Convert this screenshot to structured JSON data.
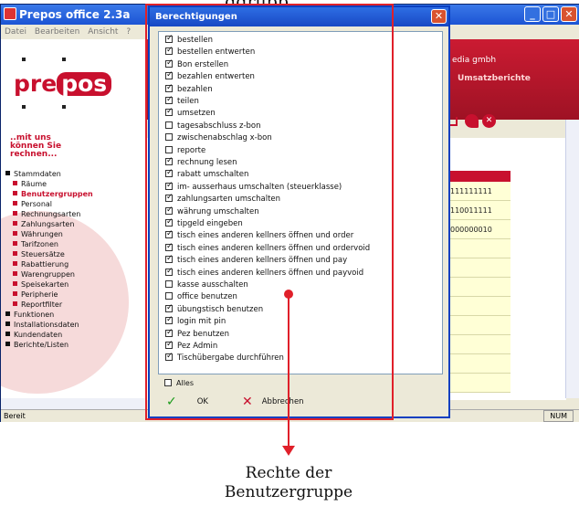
{
  "top_caption_fragment": "...ggrupp...",
  "app": {
    "title": "Prepos office 2.3a",
    "menu": [
      "Datei",
      "Bearbeiten",
      "Ansicht",
      "?"
    ],
    "logo_prefix": "pre",
    "logo_box": "pos",
    "company": "edia gmbh",
    "header_link": "Umsatzberichte",
    "slogan": [
      "..mit uns",
      "können Sie",
      "rechnen..."
    ],
    "nav": [
      {
        "label": "Stammdaten",
        "level": 1,
        "active": false
      },
      {
        "label": "Räume",
        "level": 2,
        "active": false
      },
      {
        "label": "Benutzergruppen",
        "level": 2,
        "active": true
      },
      {
        "label": "Personal",
        "level": 2,
        "active": false
      },
      {
        "label": "Rechnungsarten",
        "level": 2,
        "active": false
      },
      {
        "label": "Zahlungsarten",
        "level": 2,
        "active": false
      },
      {
        "label": "Währungen",
        "level": 2,
        "active": false
      },
      {
        "label": "Tarifzonen",
        "level": 2,
        "active": false
      },
      {
        "label": "Steuersätze",
        "level": 2,
        "active": false
      },
      {
        "label": "Rabattierung",
        "level": 2,
        "active": false
      },
      {
        "label": "Warengruppen",
        "level": 2,
        "active": false
      },
      {
        "label": "Speisekarten",
        "level": 2,
        "active": false
      },
      {
        "label": "Peripherie",
        "level": 2,
        "active": false
      },
      {
        "label": "Reportfilter",
        "level": 2,
        "active": false
      },
      {
        "label": "Funktionen",
        "level": 1,
        "active": false
      },
      {
        "label": "Installationsdaten",
        "level": 1,
        "active": false
      },
      {
        "label": "Kundendaten",
        "level": 1,
        "active": false
      },
      {
        "label": "Berichte/Listen",
        "level": 1,
        "active": false
      }
    ],
    "table_cells": [
      "111111111",
      "110011111",
      "000000010"
    ],
    "status_left": "Bereit",
    "status_right": "NUM",
    "colors": {
      "brand_red": "#c8102e",
      "xp_blue": "#1c54d4"
    }
  },
  "dialog": {
    "title": "Berechtigungen",
    "permissions": [
      {
        "label": "bestellen",
        "checked": true
      },
      {
        "label": "bestellen entwerten",
        "checked": true
      },
      {
        "label": "Bon erstellen",
        "checked": true
      },
      {
        "label": "bezahlen entwerten",
        "checked": true
      },
      {
        "label": "bezahlen",
        "checked": true
      },
      {
        "label": "teilen",
        "checked": true
      },
      {
        "label": "umsetzen",
        "checked": true
      },
      {
        "label": "tagesabschluss z-bon",
        "checked": false
      },
      {
        "label": "zwischenabschlag x-bon",
        "checked": false
      },
      {
        "label": "reporte",
        "checked": false
      },
      {
        "label": "rechnung lesen",
        "checked": true
      },
      {
        "label": "rabatt umschalten",
        "checked": true
      },
      {
        "label": "im- ausserhaus umschalten (steuerklasse)",
        "checked": true
      },
      {
        "label": "zahlungsarten umschalten",
        "checked": true
      },
      {
        "label": "währung umschalten",
        "checked": true
      },
      {
        "label": "tipgeld eingeben",
        "checked": true
      },
      {
        "label": "tisch eines anderen kellners öffnen und order",
        "checked": true
      },
      {
        "label": "tisch eines anderen kellners öffnen und ordervoid",
        "checked": true
      },
      {
        "label": "tisch eines anderen kellners öffnen und pay",
        "checked": true
      },
      {
        "label": "tisch eines anderen kellners öffnen und payvoid",
        "checked": true
      },
      {
        "label": "kasse ausschalten",
        "checked": false
      },
      {
        "label": "office benutzen",
        "checked": false
      },
      {
        "label": "übungstisch benutzen",
        "checked": true
      },
      {
        "label": "login mit pin",
        "checked": true
      },
      {
        "label": "Pez benutzen",
        "checked": true
      },
      {
        "label": "Pez Admin",
        "checked": true
      },
      {
        "label": "Tischübergabe durchführen",
        "checked": true
      }
    ],
    "select_all_label": "Alles",
    "select_all_checked": false,
    "ok_label": "OK",
    "cancel_label": "Abbrechen"
  },
  "annotation": {
    "caption_line1": "Rechte der",
    "caption_line2": "Benutzergruppe",
    "color": "#e0202a"
  }
}
